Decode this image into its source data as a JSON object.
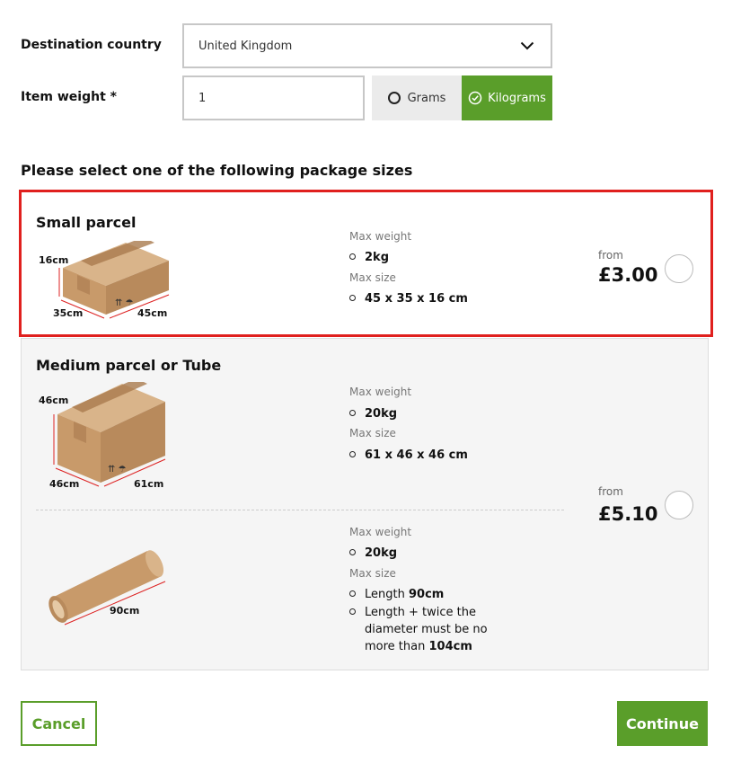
{
  "form": {
    "destination_label": "Destination country",
    "destination_value": "United Kingdom",
    "weight_label": "Item weight *",
    "weight_value": "1",
    "unit_grams": "Grams",
    "unit_kilograms": "Kilograms",
    "selected_unit": "Kilograms"
  },
  "section_title": "Please select one of the following package sizes",
  "packages": {
    "small": {
      "title": "Small parcel",
      "max_weight_label": "Max weight",
      "max_weight": "2kg",
      "max_size_label": "Max size",
      "max_size": "45 x 35 x 16 cm",
      "from_label": "from",
      "price": "£3.00",
      "dims": {
        "height": "16cm",
        "depth": "35cm",
        "width": "45cm"
      }
    },
    "medium": {
      "title": "Medium parcel or Tube",
      "box": {
        "max_weight_label": "Max weight",
        "max_weight": "20kg",
        "max_size_label": "Max size",
        "max_size": "61 x 46 x 46 cm",
        "dims": {
          "height": "46cm",
          "depth": "46cm",
          "width": "61cm"
        }
      },
      "tube": {
        "max_weight_label": "Max weight",
        "max_weight": "20kg",
        "max_size_label": "Max size",
        "length_prefix": "Length ",
        "length_value": "90cm",
        "rule_text": "Length + twice the diameter must be no more than ",
        "rule_value": "104cm",
        "dim": "90cm"
      },
      "from_label": "from",
      "price": "£5.10"
    }
  },
  "buttons": {
    "cancel": "Cancel",
    "continue": "Continue"
  },
  "colors": {
    "accent_green": "#5a9e2a",
    "highlight_red": "#e0201e"
  }
}
